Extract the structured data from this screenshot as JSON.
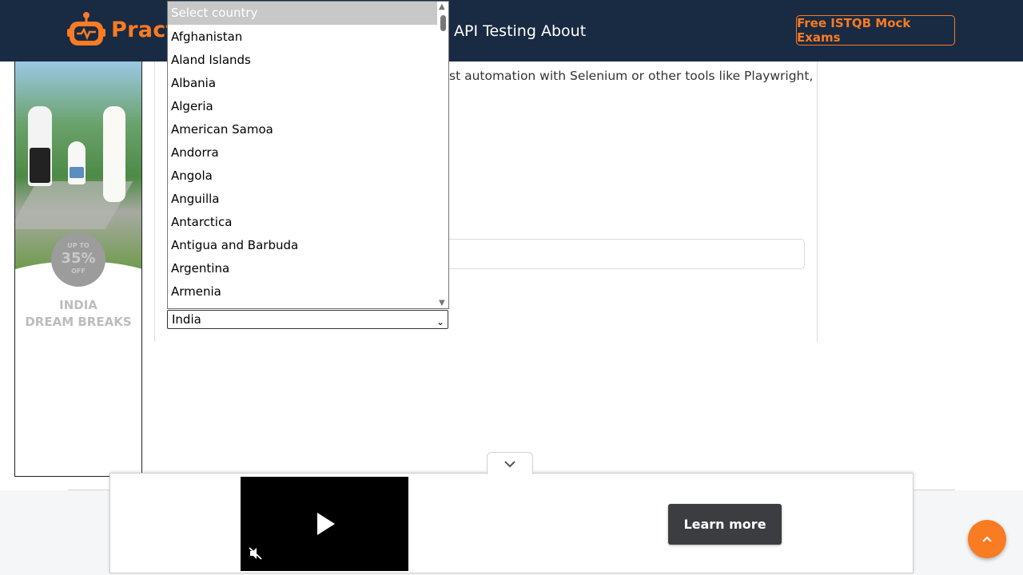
{
  "header": {
    "brand": "Pract",
    "nav": {
      "api_testing": "API Testing",
      "about": "About"
    },
    "cta": "Free ISTQB Mock Exams"
  },
  "left_ad": {
    "badge": {
      "line1": "UP TO",
      "line2": "35%",
      "line3": "OFF"
    },
    "title_line1": "INDIA",
    "title_line2": "DREAM BREAKS"
  },
  "content": {
    "text_fragment": "st automation with Selenium or other tools like Playwright,"
  },
  "country_select": {
    "value": "India",
    "options": [
      "Select country",
      "Afghanistan",
      "Aland Islands",
      "Albania",
      "Algeria",
      "American Samoa",
      "Andorra",
      "Angola",
      "Anguilla",
      "Antarctica",
      "Antigua and Barbuda",
      "Argentina",
      "Armenia"
    ],
    "highlighted": "Select country"
  },
  "bottom_ad": {
    "learn_more": "Learn more"
  },
  "icons": {
    "logo": "robot-logo-icon",
    "collapse": "chevron-down-icon",
    "play": "play-icon",
    "mute": "muted-speaker-icon",
    "scroll_top": "chevron-up-icon"
  },
  "colors": {
    "header_bg": "#192a43",
    "accent": "#f97b22",
    "learn_more_bg": "#3b3d40"
  }
}
